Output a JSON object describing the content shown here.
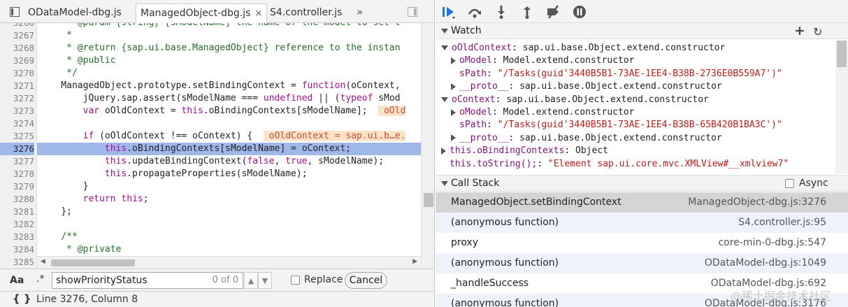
{
  "tabs": {
    "items": [
      {
        "label": "ODataModel-dbg.js"
      },
      {
        "label": "ManagedObject-dbg.js",
        "close": "×"
      },
      {
        "label": "S4.controller.js"
      }
    ],
    "overflow": "»"
  },
  "code": {
    "lines": [
      {
        "n": "3266",
        "html": "<span class=\"cm\">     * @param {string} [sModelName] the name of the model to set t</span>"
      },
      {
        "n": "3267",
        "html": "<span class=\"cm\">     *</span>"
      },
      {
        "n": "3268",
        "html": "<span class=\"cm\">     * @return {sap.ui.base.ManagedObject} reference to the instan</span>"
      },
      {
        "n": "3269",
        "html": "<span class=\"cm\">     * @public</span>"
      },
      {
        "n": "3270",
        "html": "<span class=\"cm\">     */</span>"
      },
      {
        "n": "3271",
        "html": "    ManagedObject.prototype.setBindingContext = <span class=\"kw\">function</span>(oContext,"
      },
      {
        "n": "3272",
        "html": "        jQuery.sap.assert(sModelName === <span class=\"kw\">undefined</span> || (<span class=\"kw\">typeof</span> sMod"
      },
      {
        "n": "3273",
        "html": "        <span class=\"kw\">var</span> oOldContext = <span class=\"kw\">this</span>.oBindingContexts[sModelName];  <span class=\"inl\"> oOld</span>"
      },
      {
        "n": "3274",
        "html": ""
      },
      {
        "n": "3275",
        "html": "        <span class=\"kw\">if</span> (oOldContext !== oContext) {  <span class=\"inl\"> oOldContext = sap.ui.b…e.</span>"
      },
      {
        "n": "3276",
        "html": "            <span class=\"kw\">this</span>.oBindingContexts[sModelName] = oContext;",
        "highlight": true
      },
      {
        "n": "3277",
        "html": "            <span class=\"kw\">this</span>.updateBindingContext(<span class=\"kw\">false</span>, <span class=\"kw\">true</span>, sModelName);"
      },
      {
        "n": "3278",
        "html": "            <span class=\"kw\">this</span>.propagateProperties(sModelName);"
      },
      {
        "n": "3279",
        "html": "        }"
      },
      {
        "n": "3280",
        "html": "        <span class=\"kw\">return</span> <span class=\"kw\">this</span>;"
      },
      {
        "n": "3281",
        "html": "    };"
      },
      {
        "n": "3282",
        "html": ""
      },
      {
        "n": "3283",
        "html": "<span class=\"cm\">    /**</span>"
      },
      {
        "n": "3284",
        "html": "<span class=\"cm\">     * @private</span>"
      },
      {
        "n": "3285",
        "html": ""
      }
    ]
  },
  "search": {
    "case_label": "Aa",
    "regex_label": ".*",
    "value": "showPriorityStatus",
    "count": "0 of 0",
    "up": "▲",
    "down": "▼",
    "replace_label": "Replace",
    "cancel_label": "Cancel"
  },
  "status": {
    "braces": "{ }",
    "text": "Line 3276, Column 8"
  },
  "watch": {
    "title": "Watch",
    "add": "+",
    "refresh": "↻",
    "rows": [
      {
        "indent": 0,
        "tri": "down",
        "name": "oOldContext",
        "value": "sap.ui.base.Object.extend.constructor",
        "str": false
      },
      {
        "indent": 1,
        "tri": "right",
        "name": "oModel",
        "value": "Model.extend.constructor",
        "str": false
      },
      {
        "indent": 1,
        "tri": "none",
        "name": "sPath",
        "value": "\"/Tasks(guid'3440B5B1-73AE-1EE4-B38B-2736E0B559A7')\"",
        "str": true
      },
      {
        "indent": 1,
        "tri": "right",
        "name": "__proto__",
        "value": "sap.ui.base.Object.extend.constructor",
        "str": false
      },
      {
        "indent": 0,
        "tri": "down",
        "name": "oContext",
        "value": "sap.ui.base.Object.extend.constructor",
        "str": false
      },
      {
        "indent": 1,
        "tri": "right",
        "name": "oModel",
        "value": "Model.extend.constructor",
        "str": false
      },
      {
        "indent": 1,
        "tri": "none",
        "name": "sPath",
        "value": "\"/Tasks(guid'3440B5B1-73AE-1EE4-B38B-65B420B1BA3C')\"",
        "str": true
      },
      {
        "indent": 1,
        "tri": "right",
        "name": "__proto__",
        "value": "sap.ui.base.Object.extend.constructor",
        "str": false
      },
      {
        "indent": 0,
        "tri": "right",
        "name": "this.oBindingContexts",
        "value": "Object",
        "str": false
      },
      {
        "indent": 0,
        "tri": "none",
        "name": "this.toString();",
        "value": "\"Element sap.ui.core.mvc.XMLView#__xmlview7\"",
        "str": true
      }
    ]
  },
  "callstack": {
    "title": "Call Stack",
    "async_label": "Async",
    "frames": [
      {
        "name": "ManagedObject.setBindingContext",
        "loc": "ManagedObject-dbg.js:3276",
        "selected": true
      },
      {
        "name": "(anonymous function)",
        "loc": "S4.controller.js:95"
      },
      {
        "name": "proxy",
        "loc": "core-min-0-dbg.js:547"
      },
      {
        "name": "(anonymous function)",
        "loc": "ODataModel-dbg.js:1049"
      },
      {
        "name": "_handleSuccess",
        "loc": "ODataModel-dbg.js:692"
      },
      {
        "name": "(anonymous function)",
        "loc": "ODataModel-dbg.js:3176"
      }
    ]
  },
  "watermark": "@稀土掘金技术社区",
  "colors": {
    "accent": "#1a73e8",
    "highlight": "#9fb8ea",
    "keyword": "#aa0d91",
    "comment": "#236e25",
    "string": "#c41a16"
  }
}
